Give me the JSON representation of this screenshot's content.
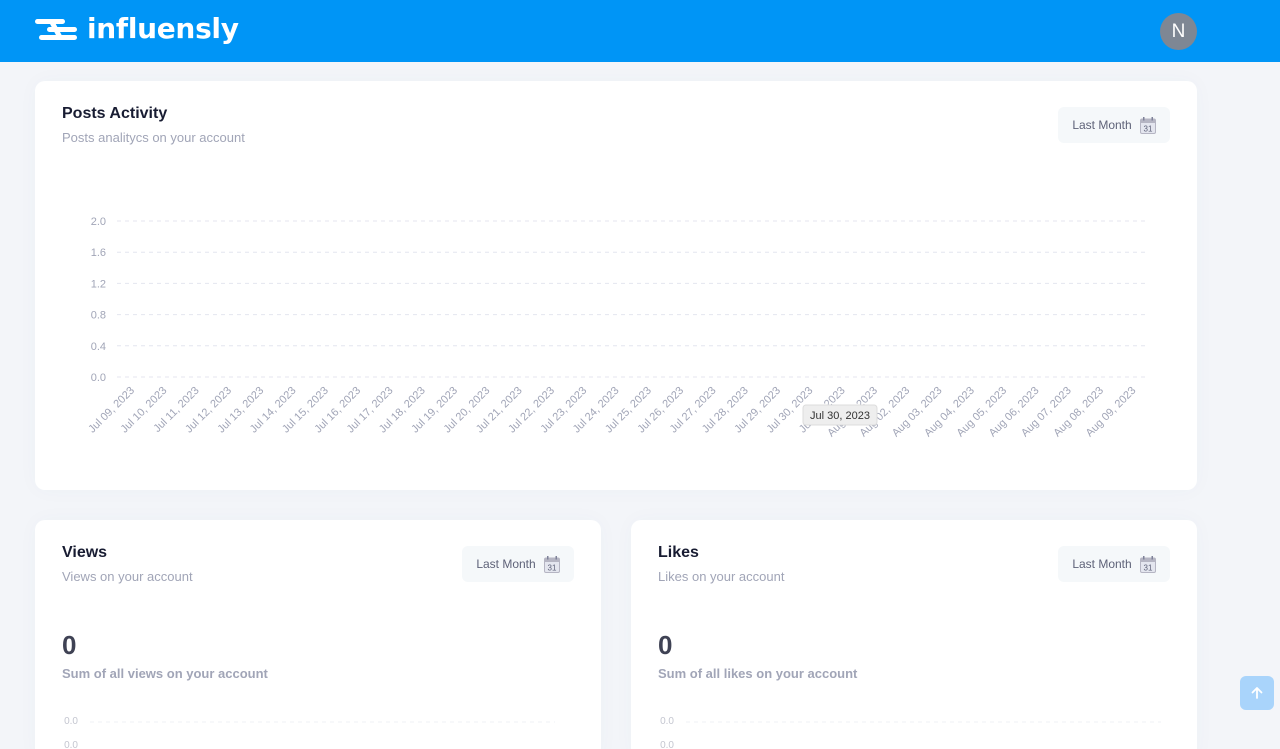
{
  "brand": {
    "name": "influensly"
  },
  "user": {
    "initial": "N"
  },
  "posts_card": {
    "title": "Posts Activity",
    "subtitle": "Posts analitycs on your account",
    "range_label": "Last Month",
    "calendar_day": "31",
    "tooltip": "Jul 30, 2023"
  },
  "views_card": {
    "title": "Views",
    "subtitle": "Views on your account",
    "range_label": "Last Month",
    "calendar_day": "31",
    "total": "0",
    "total_caption": "Sum of all views on your account",
    "y_ticks": [
      "0.0",
      "0.0"
    ]
  },
  "likes_card": {
    "title": "Likes",
    "subtitle": "Likes on your account",
    "range_label": "Last Month",
    "calendar_day": "31",
    "total": "0",
    "total_caption": "Sum of all likes on your account",
    "y_ticks": [
      "0.0",
      "0.0"
    ]
  },
  "colors": {
    "brand": "#0095f6",
    "avatar": "#7e8794",
    "scroll_top": "#a9d4fb"
  },
  "icons": {
    "scroll_top": "arrow-up-icon",
    "calendar": "calendar-icon"
  },
  "chart_data": {
    "type": "line",
    "title": "Posts Activity",
    "ylim": [
      0,
      2.0
    ],
    "y_ticks": [
      0.0,
      0.4,
      0.8,
      1.2,
      1.6,
      2.0
    ],
    "grid": true,
    "categories": [
      "Jul 09, 2023",
      "Jul 10, 2023",
      "Jul 11, 2023",
      "Jul 12, 2023",
      "Jul 13, 2023",
      "Jul 14, 2023",
      "Jul 15, 2023",
      "Jul 16, 2023",
      "Jul 17, 2023",
      "Jul 18, 2023",
      "Jul 19, 2023",
      "Jul 20, 2023",
      "Jul 21, 2023",
      "Jul 22, 2023",
      "Jul 23, 2023",
      "Jul 24, 2023",
      "Jul 25, 2023",
      "Jul 26, 2023",
      "Jul 27, 2023",
      "Jul 28, 2023",
      "Jul 29, 2023",
      "Jul 30, 2023",
      "Jul 31, 2023",
      "Aug 01, 2023",
      "Aug 02, 2023",
      "Aug 03, 2023",
      "Aug 04, 2023",
      "Aug 05, 2023",
      "Aug 06, 2023",
      "Aug 07, 2023",
      "Aug 08, 2023",
      "Aug 09, 2023"
    ],
    "values": [
      0,
      0,
      0,
      0,
      0,
      0,
      0,
      0,
      0,
      0,
      0,
      0,
      0,
      0,
      0,
      0,
      0,
      0,
      0,
      0,
      0,
      0,
      0,
      0,
      0,
      0,
      0,
      0,
      0,
      0,
      0,
      0
    ]
  }
}
